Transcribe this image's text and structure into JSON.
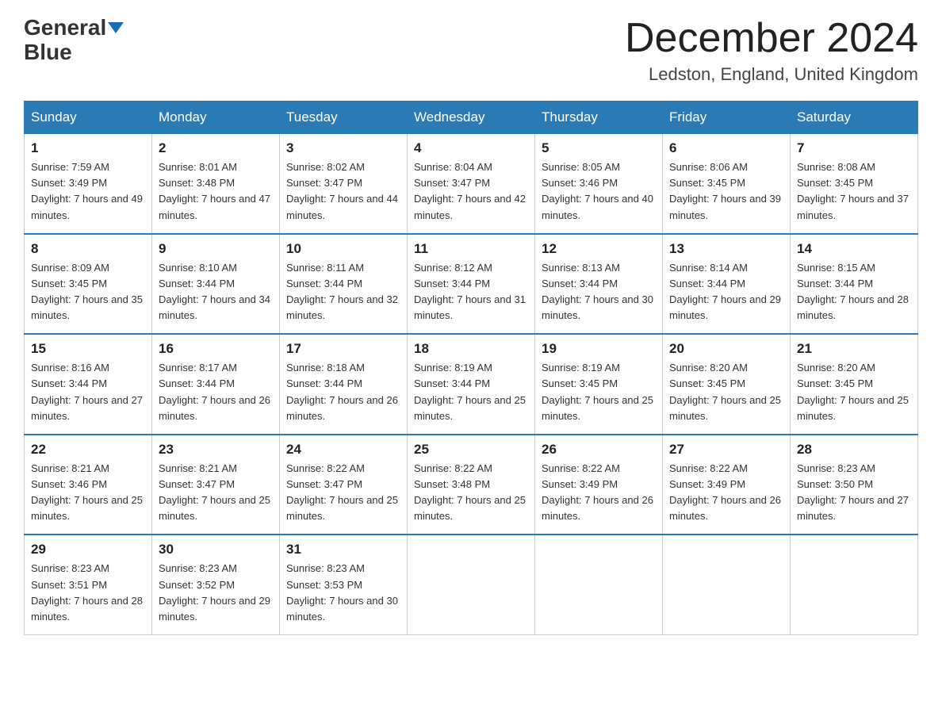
{
  "logo": {
    "text_general": "General",
    "text_blue": "Blue"
  },
  "title": "December 2024",
  "location": "Ledston, England, United Kingdom",
  "days_of_week": [
    "Sunday",
    "Monday",
    "Tuesday",
    "Wednesday",
    "Thursday",
    "Friday",
    "Saturday"
  ],
  "weeks": [
    [
      {
        "day": "1",
        "sunrise": "7:59 AM",
        "sunset": "3:49 PM",
        "daylight": "7 hours and 49 minutes."
      },
      {
        "day": "2",
        "sunrise": "8:01 AM",
        "sunset": "3:48 PM",
        "daylight": "7 hours and 47 minutes."
      },
      {
        "day": "3",
        "sunrise": "8:02 AM",
        "sunset": "3:47 PM",
        "daylight": "7 hours and 44 minutes."
      },
      {
        "day": "4",
        "sunrise": "8:04 AM",
        "sunset": "3:47 PM",
        "daylight": "7 hours and 42 minutes."
      },
      {
        "day": "5",
        "sunrise": "8:05 AM",
        "sunset": "3:46 PM",
        "daylight": "7 hours and 40 minutes."
      },
      {
        "day": "6",
        "sunrise": "8:06 AM",
        "sunset": "3:45 PM",
        "daylight": "7 hours and 39 minutes."
      },
      {
        "day": "7",
        "sunrise": "8:08 AM",
        "sunset": "3:45 PM",
        "daylight": "7 hours and 37 minutes."
      }
    ],
    [
      {
        "day": "8",
        "sunrise": "8:09 AM",
        "sunset": "3:45 PM",
        "daylight": "7 hours and 35 minutes."
      },
      {
        "day": "9",
        "sunrise": "8:10 AM",
        "sunset": "3:44 PM",
        "daylight": "7 hours and 34 minutes."
      },
      {
        "day": "10",
        "sunrise": "8:11 AM",
        "sunset": "3:44 PM",
        "daylight": "7 hours and 32 minutes."
      },
      {
        "day": "11",
        "sunrise": "8:12 AM",
        "sunset": "3:44 PM",
        "daylight": "7 hours and 31 minutes."
      },
      {
        "day": "12",
        "sunrise": "8:13 AM",
        "sunset": "3:44 PM",
        "daylight": "7 hours and 30 minutes."
      },
      {
        "day": "13",
        "sunrise": "8:14 AM",
        "sunset": "3:44 PM",
        "daylight": "7 hours and 29 minutes."
      },
      {
        "day": "14",
        "sunrise": "8:15 AM",
        "sunset": "3:44 PM",
        "daylight": "7 hours and 28 minutes."
      }
    ],
    [
      {
        "day": "15",
        "sunrise": "8:16 AM",
        "sunset": "3:44 PM",
        "daylight": "7 hours and 27 minutes."
      },
      {
        "day": "16",
        "sunrise": "8:17 AM",
        "sunset": "3:44 PM",
        "daylight": "7 hours and 26 minutes."
      },
      {
        "day": "17",
        "sunrise": "8:18 AM",
        "sunset": "3:44 PM",
        "daylight": "7 hours and 26 minutes."
      },
      {
        "day": "18",
        "sunrise": "8:19 AM",
        "sunset": "3:44 PM",
        "daylight": "7 hours and 25 minutes."
      },
      {
        "day": "19",
        "sunrise": "8:19 AM",
        "sunset": "3:45 PM",
        "daylight": "7 hours and 25 minutes."
      },
      {
        "day": "20",
        "sunrise": "8:20 AM",
        "sunset": "3:45 PM",
        "daylight": "7 hours and 25 minutes."
      },
      {
        "day": "21",
        "sunrise": "8:20 AM",
        "sunset": "3:45 PM",
        "daylight": "7 hours and 25 minutes."
      }
    ],
    [
      {
        "day": "22",
        "sunrise": "8:21 AM",
        "sunset": "3:46 PM",
        "daylight": "7 hours and 25 minutes."
      },
      {
        "day": "23",
        "sunrise": "8:21 AM",
        "sunset": "3:47 PM",
        "daylight": "7 hours and 25 minutes."
      },
      {
        "day": "24",
        "sunrise": "8:22 AM",
        "sunset": "3:47 PM",
        "daylight": "7 hours and 25 minutes."
      },
      {
        "day": "25",
        "sunrise": "8:22 AM",
        "sunset": "3:48 PM",
        "daylight": "7 hours and 25 minutes."
      },
      {
        "day": "26",
        "sunrise": "8:22 AM",
        "sunset": "3:49 PM",
        "daylight": "7 hours and 26 minutes."
      },
      {
        "day": "27",
        "sunrise": "8:22 AM",
        "sunset": "3:49 PM",
        "daylight": "7 hours and 26 minutes."
      },
      {
        "day": "28",
        "sunrise": "8:23 AM",
        "sunset": "3:50 PM",
        "daylight": "7 hours and 27 minutes."
      }
    ],
    [
      {
        "day": "29",
        "sunrise": "8:23 AM",
        "sunset": "3:51 PM",
        "daylight": "7 hours and 28 minutes."
      },
      {
        "day": "30",
        "sunrise": "8:23 AM",
        "sunset": "3:52 PM",
        "daylight": "7 hours and 29 minutes."
      },
      {
        "day": "31",
        "sunrise": "8:23 AM",
        "sunset": "3:53 PM",
        "daylight": "7 hours and 30 minutes."
      },
      null,
      null,
      null,
      null
    ]
  ],
  "labels": {
    "sunrise_prefix": "Sunrise: ",
    "sunset_prefix": "Sunset: ",
    "daylight_prefix": "Daylight: "
  }
}
